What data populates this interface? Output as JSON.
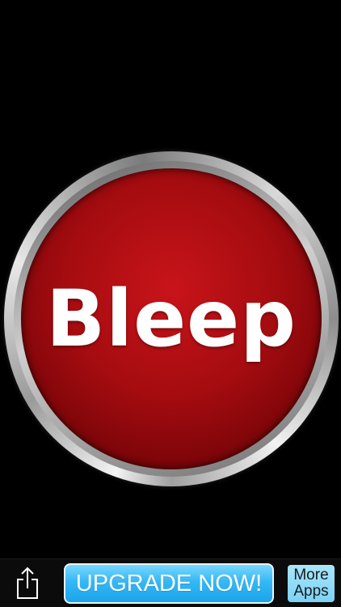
{
  "main": {
    "bleep_label": "Bleep"
  },
  "bottom_bar": {
    "share_icon": "share-icon",
    "upgrade_label": "UPGRADE NOW!",
    "more_apps_line1": "More",
    "more_apps_line2": "Apps"
  },
  "colors": {
    "background": "#000000",
    "button_red": "#b0101a",
    "upgrade_blue": "#34b8f6",
    "more_apps_blue": "#7bd2f6"
  }
}
